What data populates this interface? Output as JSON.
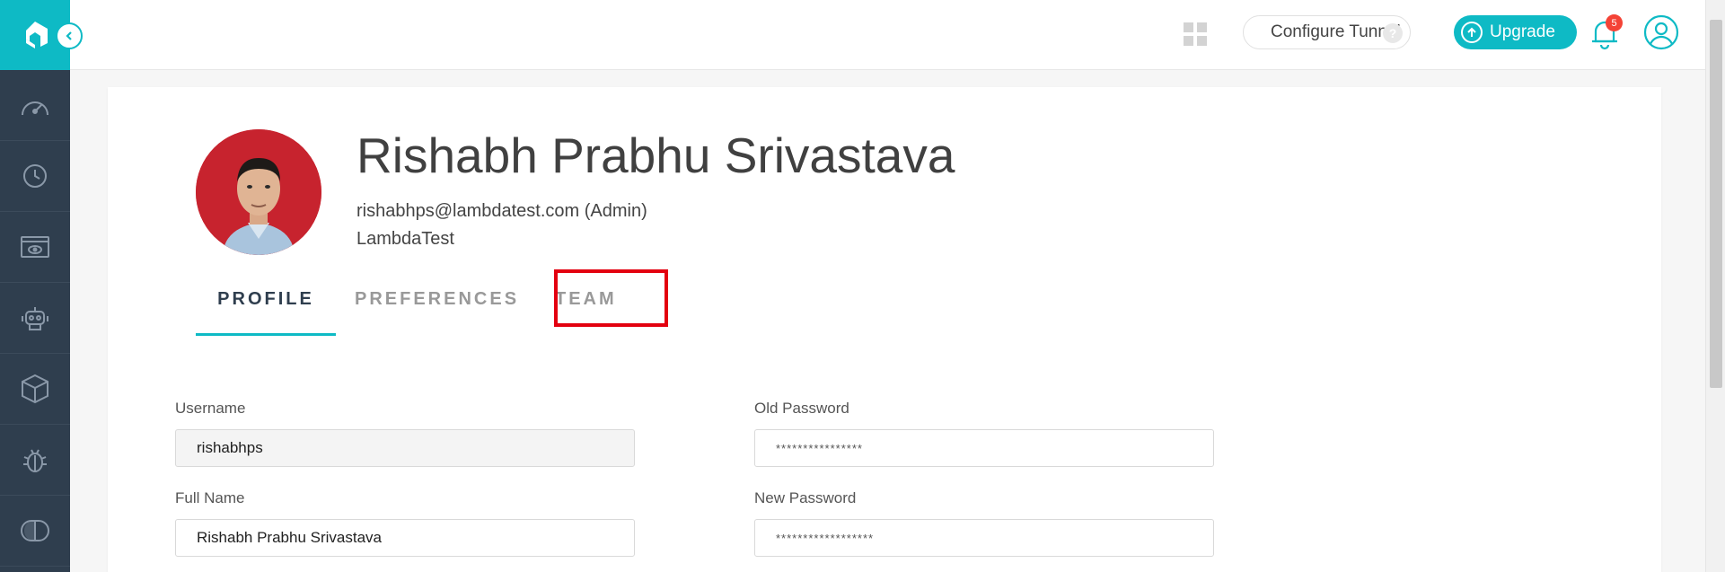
{
  "header": {
    "configure_tunnel_label": "Configure Tunnel",
    "tunnel_help": "?",
    "upgrade_label": "Upgrade",
    "notification_count": "5"
  },
  "sidebar": {
    "items": [
      {
        "icon": "dashboard-icon"
      },
      {
        "icon": "history-icon"
      },
      {
        "icon": "browser-icon"
      },
      {
        "icon": "robot-icon"
      },
      {
        "icon": "box-icon"
      },
      {
        "icon": "bug-icon"
      },
      {
        "icon": "compare-icon"
      }
    ]
  },
  "profile": {
    "name": "Rishabh Prabhu Srivastava",
    "email": "rishabhps@lambdatest.com (Admin)",
    "organization": "LambdaTest"
  },
  "tabs": {
    "profile": "PROFILE",
    "preferences": "PREFERENCES",
    "team": "TEAM"
  },
  "form": {
    "username_label": "Username",
    "username_value": "rishabhps",
    "fullname_label": "Full Name",
    "fullname_value": "Rishabh Prabhu Srivastava",
    "old_password_label": "Old Password",
    "old_password_value": "****************",
    "new_password_label": "New Password",
    "new_password_value": "******************"
  },
  "colors": {
    "accent": "#0ebac5",
    "sidebar": "#2f3e4e",
    "highlight": "#e3000f",
    "badge": "#f44336"
  }
}
